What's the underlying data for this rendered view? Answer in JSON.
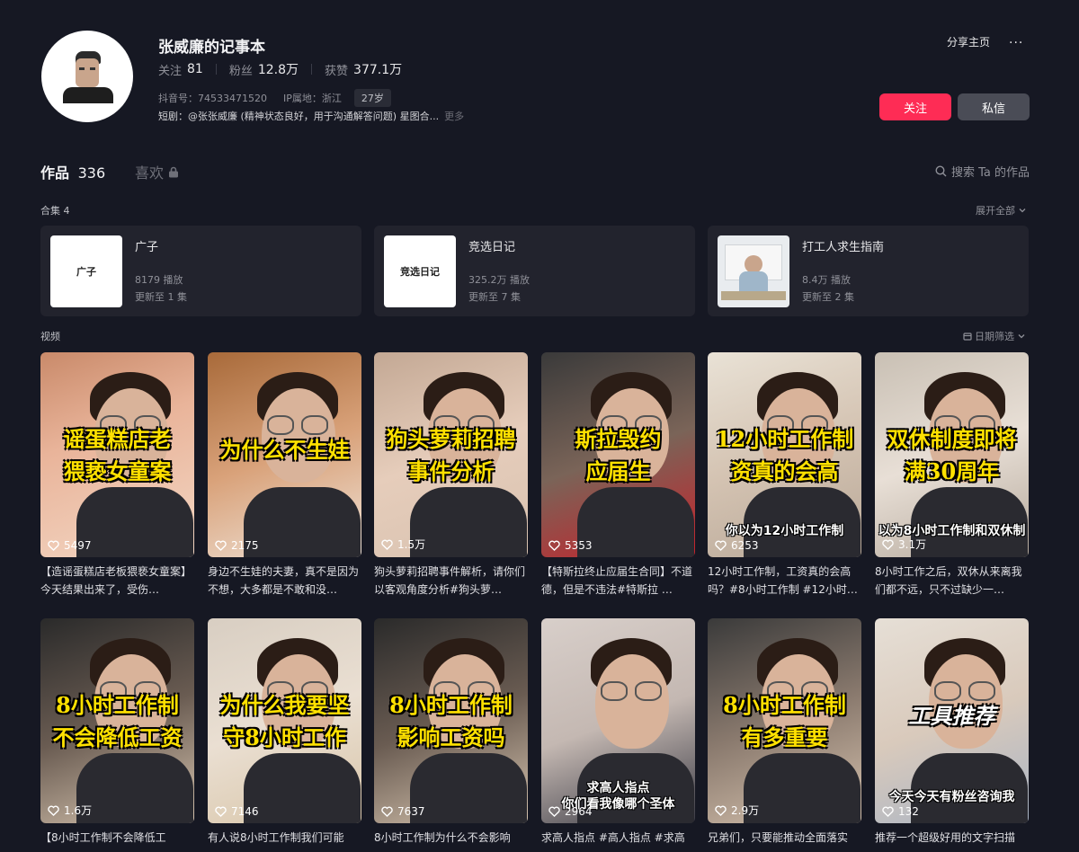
{
  "profile": {
    "name": "张威廉的记事本",
    "following_label": "关注",
    "following": "81",
    "fans_label": "粉丝",
    "fans": "12.8万",
    "likes_label": "获赞",
    "likes": "377.1万",
    "douyin_id": "抖音号：74533471520",
    "ip": "IP属地：浙江",
    "age": "27岁",
    "bio": "短剧：@张张威廉 (精神状态良好，用于沟通解答问题) 星图合...",
    "bio_more": "更多",
    "share": "分享主页",
    "more_dots": "...",
    "follow_btn": "关注",
    "message_btn": "私信"
  },
  "tabs": {
    "works_label": "作品",
    "works_count": "336",
    "likes_label": "喜欢",
    "search": "搜索 Ta 的作品"
  },
  "collections": {
    "title": "合集 4",
    "expand": "展开全部",
    "items": [
      {
        "thumb_text": "广子",
        "title": "广子",
        "plays": "8179 播放",
        "updated": "更新至 1 集"
      },
      {
        "thumb_text": "竞选日记",
        "title": "竞选日记",
        "plays": "325.2万 播放",
        "updated": "更新至 7 集"
      },
      {
        "thumb_text": "",
        "title": "打工人求生指南",
        "plays": "8.4万 播放",
        "updated": "更新至 2 集"
      }
    ]
  },
  "videos": {
    "title": "视频",
    "date_filter": "日期筛选",
    "items": [
      {
        "overlay": [
          "谣蛋糕店老",
          "猥亵女童案"
        ],
        "sub": "",
        "likes": "5497",
        "caption": "【造谣蛋糕店老板猥亵女童案】今天结果出来了，受伤…"
      },
      {
        "overlay": [
          "为什么不生娃"
        ],
        "sub": "",
        "likes": "2175",
        "caption": "身边不生娃的夫妻，真不是因为不想，大多都是不敢和没…"
      },
      {
        "overlay": [
          "狗头萝莉招聘",
          "事件分析"
        ],
        "sub": "",
        "likes": "1.5万",
        "caption": "狗头萝莉招聘事件解析，请你们以客观角度分析#狗头萝…"
      },
      {
        "overlay": [
          "斯拉毁约",
          "应届生"
        ],
        "sub": "",
        "likes": "5353",
        "caption": "【特斯拉终止应届生合同】不道德，但是不违法#特斯拉 …"
      },
      {
        "overlay": [
          "12小时工作制",
          "资真的会高"
        ],
        "sub": "你以为12小时工作制",
        "likes": "6253",
        "caption": "12小时工作制，工资真的会高吗？#8小时工作制 #12小时…"
      },
      {
        "overlay": [
          "双休制度即将",
          "满30周年"
        ],
        "sub": "以为8小时工作制和双休制",
        "likes": "3.1万",
        "caption": "8小时工作之后，双休从来离我们都不远，只不过缺少一…"
      },
      {
        "overlay": [
          "8小时工作制",
          "不会降低工资"
        ],
        "sub": "",
        "likes": "1.6万",
        "caption": "【8小时工作制不会降低工"
      },
      {
        "overlay": [
          "为什么我要坚",
          "守8小时工作"
        ],
        "sub": "",
        "likes": "7146",
        "caption": "有人说8小时工作制我们可能"
      },
      {
        "overlay": [
          "8小时工作制",
          "影响工资吗"
        ],
        "sub": "",
        "likes": "7637",
        "caption": "8小时工作制为什么不会影响"
      },
      {
        "overlay": [],
        "sub": "求高人指点",
        "sub2": "你们看我像哪个圣体",
        "likes": "2964",
        "caption": "求高人指点 #高人指点 #求高"
      },
      {
        "overlay": [
          "8小时工作制",
          "有多重要"
        ],
        "sub": "",
        "likes": "2.9万",
        "caption": "兄弟们，只要能推动全面落实"
      },
      {
        "overlay": [
          "工具推荐"
        ],
        "sub": "今天今天有粉丝咨询我",
        "likes": "132",
        "caption": "推荐一个超级好用的文字扫描"
      }
    ]
  },
  "colors": {
    "accent": "#fe2c55",
    "bg": "#161823",
    "card": "#22232d",
    "overlay_text": "#ffe100"
  }
}
